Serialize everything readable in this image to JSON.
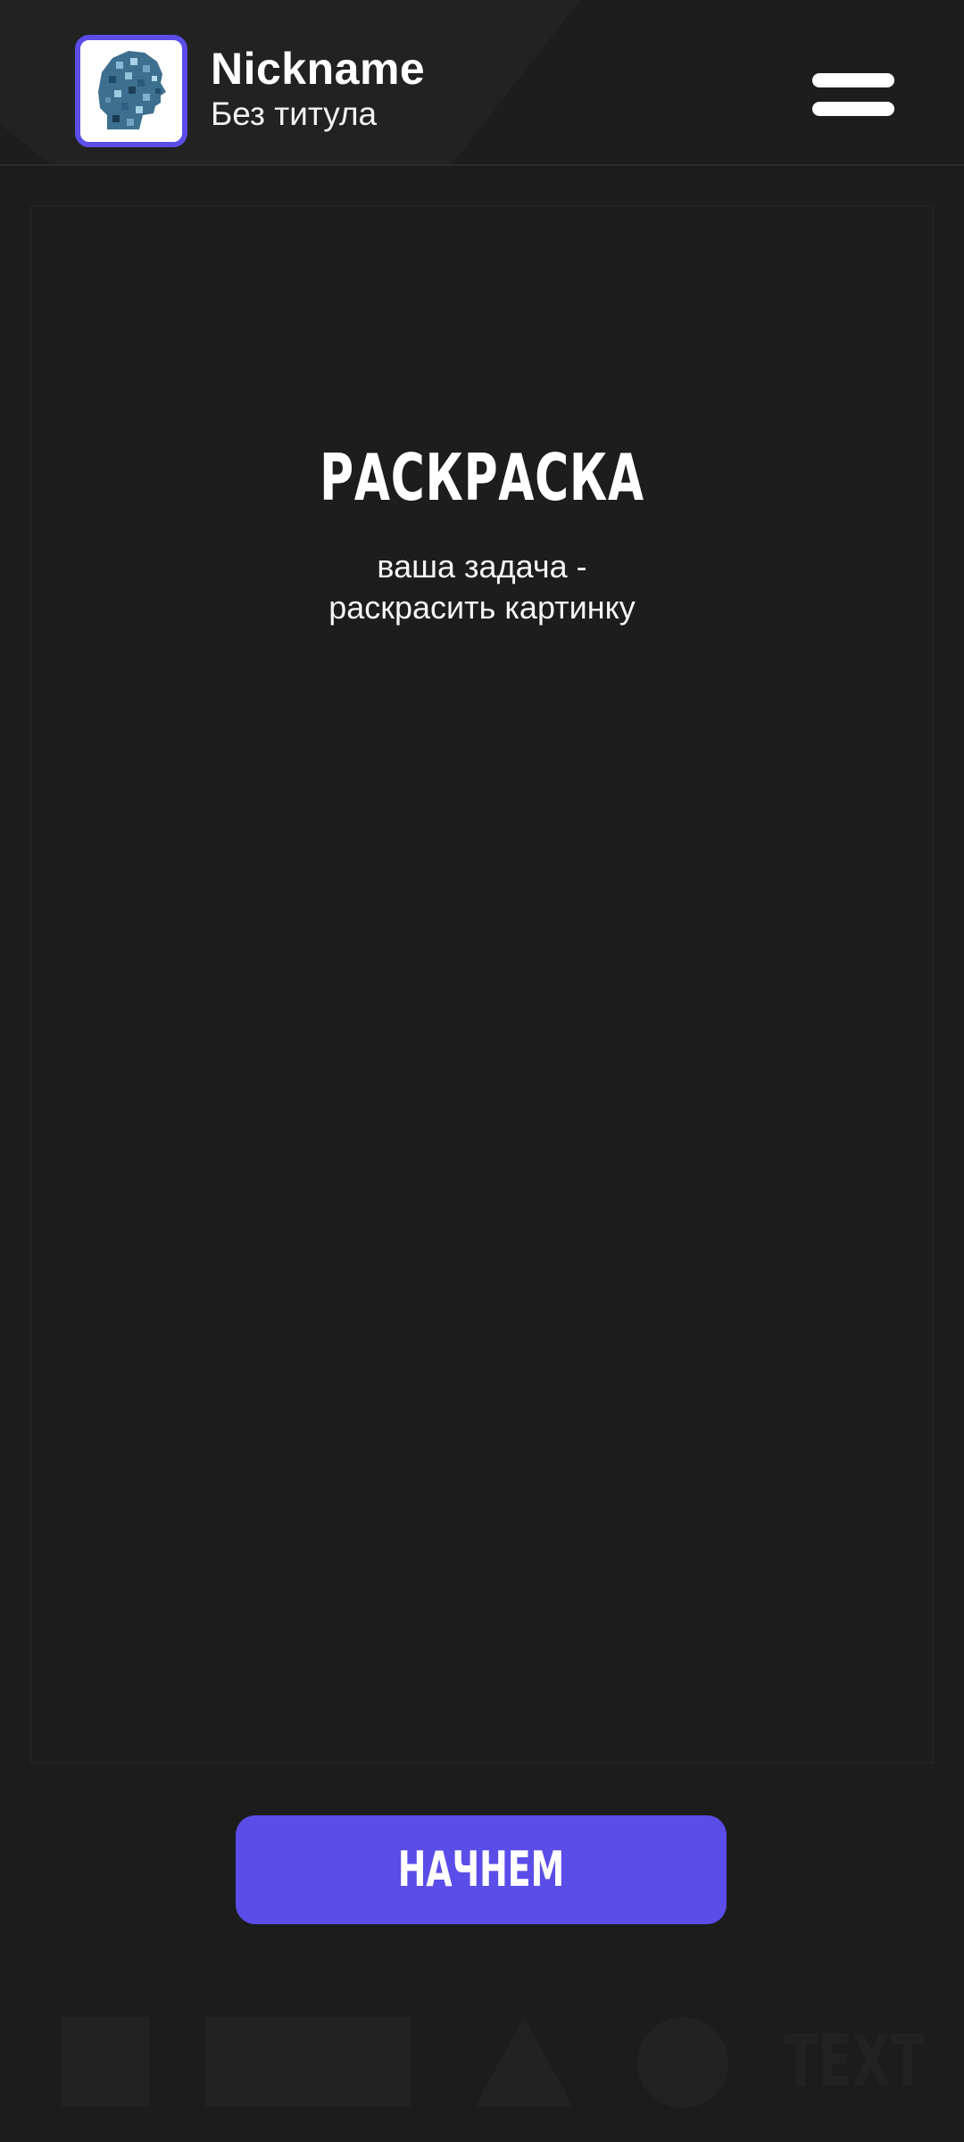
{
  "header": {
    "nickname": "Nickname",
    "player_title": "Без титула",
    "avatar_icon": "pixel-head-icon",
    "menu_icon": "hamburger-menu-icon"
  },
  "game": {
    "title": "РАСКРАСКА",
    "description_line1": "ваша задача -",
    "description_line2": "раскрасить картинку"
  },
  "start_button": {
    "label": "НАЧНЕМ"
  },
  "footer_shapes": {
    "items": [
      "square",
      "rectangle",
      "triangle",
      "circle",
      "text"
    ],
    "text_label": "TEXT"
  },
  "colors": {
    "background": "#1c1c1c",
    "accent": "#5a4de8",
    "text": "#ffffff",
    "decor": "#222222"
  }
}
